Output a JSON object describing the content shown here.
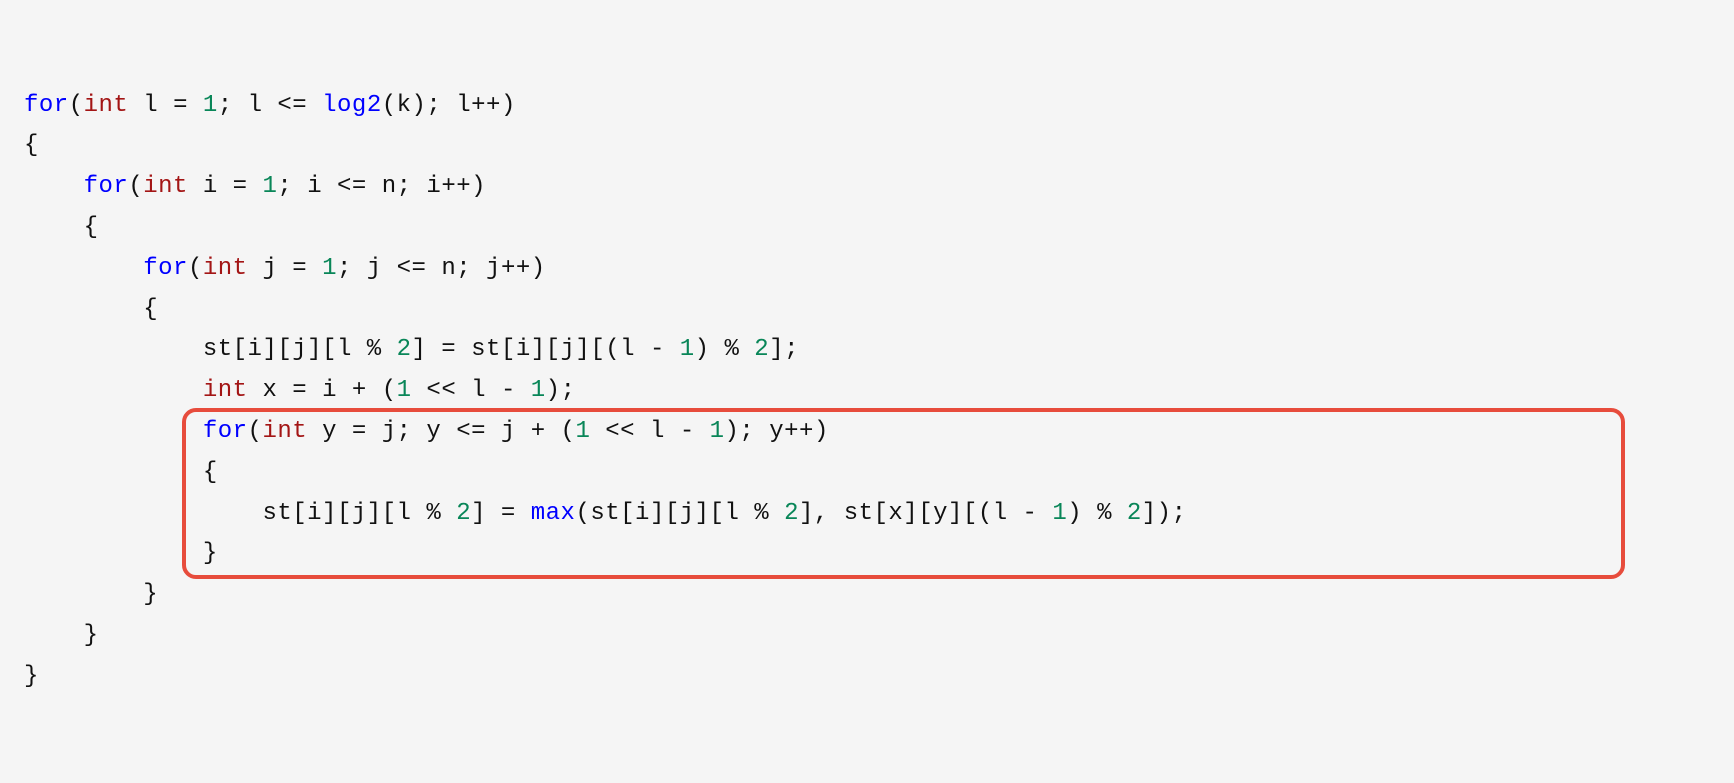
{
  "code": {
    "indent": "    ",
    "hl_start_line": 8,
    "hl_end_line": 11,
    "hl_left_ch": 11,
    "hl_right_ch": 107,
    "lines": [
      [
        {
          "t": "for",
          "c": "kw"
        },
        {
          "t": "(",
          "c": "punc"
        },
        {
          "t": "int",
          "c": "type"
        },
        {
          "t": " l ",
          "c": "id"
        },
        {
          "t": "=",
          "c": "op"
        },
        {
          "t": " ",
          "c": "id"
        },
        {
          "t": "1",
          "c": "num"
        },
        {
          "t": "; l ",
          "c": "id"
        },
        {
          "t": "<=",
          "c": "op"
        },
        {
          "t": " ",
          "c": "id"
        },
        {
          "t": "log2",
          "c": "func"
        },
        {
          "t": "(k); l",
          "c": "id"
        },
        {
          "t": "++",
          "c": "op"
        },
        {
          "t": ")",
          "c": "punc"
        }
      ],
      [
        {
          "t": "{",
          "c": "punc"
        }
      ],
      [
        {
          "t": "    ",
          "c": "id"
        },
        {
          "t": "for",
          "c": "kw"
        },
        {
          "t": "(",
          "c": "punc"
        },
        {
          "t": "int",
          "c": "type"
        },
        {
          "t": " i ",
          "c": "id"
        },
        {
          "t": "=",
          "c": "op"
        },
        {
          "t": " ",
          "c": "id"
        },
        {
          "t": "1",
          "c": "num"
        },
        {
          "t": "; i ",
          "c": "id"
        },
        {
          "t": "<=",
          "c": "op"
        },
        {
          "t": " n; i",
          "c": "id"
        },
        {
          "t": "++",
          "c": "op"
        },
        {
          "t": ")",
          "c": "punc"
        }
      ],
      [
        {
          "t": "    {",
          "c": "punc"
        }
      ],
      [
        {
          "t": "        ",
          "c": "id"
        },
        {
          "t": "for",
          "c": "kw"
        },
        {
          "t": "(",
          "c": "punc"
        },
        {
          "t": "int",
          "c": "type"
        },
        {
          "t": " j ",
          "c": "id"
        },
        {
          "t": "=",
          "c": "op"
        },
        {
          "t": " ",
          "c": "id"
        },
        {
          "t": "1",
          "c": "num"
        },
        {
          "t": "; j ",
          "c": "id"
        },
        {
          "t": "<=",
          "c": "op"
        },
        {
          "t": " n; j",
          "c": "id"
        },
        {
          "t": "++",
          "c": "op"
        },
        {
          "t": ")",
          "c": "punc"
        }
      ],
      [
        {
          "t": "        {",
          "c": "punc"
        }
      ],
      [
        {
          "t": "            st[i][j][l ",
          "c": "id"
        },
        {
          "t": "%",
          "c": "op"
        },
        {
          "t": " ",
          "c": "id"
        },
        {
          "t": "2",
          "c": "num"
        },
        {
          "t": "] ",
          "c": "id"
        },
        {
          "t": "=",
          "c": "op"
        },
        {
          "t": " st[i][j][(l ",
          "c": "id"
        },
        {
          "t": "-",
          "c": "op"
        },
        {
          "t": " ",
          "c": "id"
        },
        {
          "t": "1",
          "c": "num"
        },
        {
          "t": ") ",
          "c": "id"
        },
        {
          "t": "%",
          "c": "op"
        },
        {
          "t": " ",
          "c": "id"
        },
        {
          "t": "2",
          "c": "num"
        },
        {
          "t": "];",
          "c": "id"
        }
      ],
      [
        {
          "t": "            ",
          "c": "id"
        },
        {
          "t": "int",
          "c": "type"
        },
        {
          "t": " x ",
          "c": "id"
        },
        {
          "t": "=",
          "c": "op"
        },
        {
          "t": " i ",
          "c": "id"
        },
        {
          "t": "+",
          "c": "op"
        },
        {
          "t": " (",
          "c": "id"
        },
        {
          "t": "1",
          "c": "num"
        },
        {
          "t": " ",
          "c": "id"
        },
        {
          "t": "<<",
          "c": "op"
        },
        {
          "t": " l ",
          "c": "id"
        },
        {
          "t": "-",
          "c": "op"
        },
        {
          "t": " ",
          "c": "id"
        },
        {
          "t": "1",
          "c": "num"
        },
        {
          "t": ");",
          "c": "id"
        }
      ],
      [
        {
          "t": "            ",
          "c": "id"
        },
        {
          "t": "for",
          "c": "kw"
        },
        {
          "t": "(",
          "c": "punc"
        },
        {
          "t": "int",
          "c": "type"
        },
        {
          "t": " y ",
          "c": "id"
        },
        {
          "t": "=",
          "c": "op"
        },
        {
          "t": " j; y ",
          "c": "id"
        },
        {
          "t": "<=",
          "c": "op"
        },
        {
          "t": " j ",
          "c": "id"
        },
        {
          "t": "+",
          "c": "op"
        },
        {
          "t": " (",
          "c": "id"
        },
        {
          "t": "1",
          "c": "num"
        },
        {
          "t": " ",
          "c": "id"
        },
        {
          "t": "<<",
          "c": "op"
        },
        {
          "t": " l ",
          "c": "id"
        },
        {
          "t": "-",
          "c": "op"
        },
        {
          "t": " ",
          "c": "id"
        },
        {
          "t": "1",
          "c": "num"
        },
        {
          "t": "); y",
          "c": "id"
        },
        {
          "t": "++",
          "c": "op"
        },
        {
          "t": ")",
          "c": "punc"
        }
      ],
      [
        {
          "t": "            {",
          "c": "punc"
        }
      ],
      [
        {
          "t": "                st[i][j][l ",
          "c": "id"
        },
        {
          "t": "%",
          "c": "op"
        },
        {
          "t": " ",
          "c": "id"
        },
        {
          "t": "2",
          "c": "num"
        },
        {
          "t": "] ",
          "c": "id"
        },
        {
          "t": "=",
          "c": "op"
        },
        {
          "t": " ",
          "c": "id"
        },
        {
          "t": "max",
          "c": "func"
        },
        {
          "t": "(st[i][j][l ",
          "c": "id"
        },
        {
          "t": "%",
          "c": "op"
        },
        {
          "t": " ",
          "c": "id"
        },
        {
          "t": "2",
          "c": "num"
        },
        {
          "t": "], st[x][y][(l ",
          "c": "id"
        },
        {
          "t": "-",
          "c": "op"
        },
        {
          "t": " ",
          "c": "id"
        },
        {
          "t": "1",
          "c": "num"
        },
        {
          "t": ") ",
          "c": "id"
        },
        {
          "t": "%",
          "c": "op"
        },
        {
          "t": " ",
          "c": "id"
        },
        {
          "t": "2",
          "c": "num"
        },
        {
          "t": "]);",
          "c": "id"
        }
      ],
      [
        {
          "t": "            }",
          "c": "punc"
        }
      ],
      [
        {
          "t": "        }",
          "c": "punc"
        }
      ],
      [
        {
          "t": "    }",
          "c": "punc"
        }
      ],
      [
        {
          "t": "}",
          "c": "punc"
        }
      ]
    ]
  }
}
